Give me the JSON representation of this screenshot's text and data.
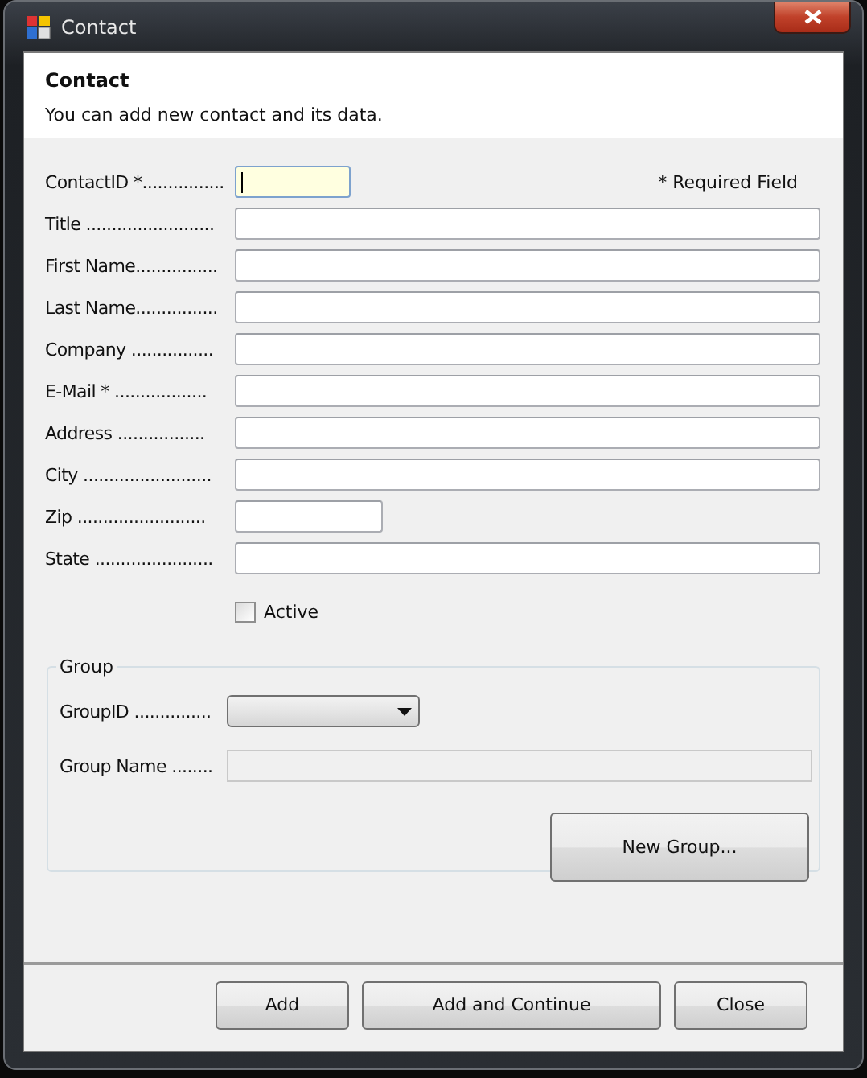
{
  "window": {
    "title": "Contact"
  },
  "header": {
    "title": "Contact",
    "subtitle": "You can add new contact and its data."
  },
  "required_note": "* Required Field",
  "fields": [
    {
      "label": "ContactID *................",
      "kind": "id",
      "focused": true
    },
    {
      "label": "Title .........................",
      "kind": "wide",
      "focused": false
    },
    {
      "label": "First Name................",
      "kind": "wide",
      "focused": false
    },
    {
      "label": "Last Name................",
      "kind": "wide",
      "focused": false
    },
    {
      "label": "Company ................",
      "kind": "wide",
      "focused": false
    },
    {
      "label": "E-Mail * ..................",
      "kind": "wide",
      "focused": false
    },
    {
      "label": "Address  .................",
      "kind": "wide",
      "focused": false
    },
    {
      "label": "City  .........................",
      "kind": "wide",
      "focused": false
    },
    {
      "label": "Zip  .........................",
      "kind": "short",
      "focused": false
    },
    {
      "label": "State  .......................",
      "kind": "wide",
      "focused": false
    }
  ],
  "active": {
    "label": "Active",
    "checked": false
  },
  "group": {
    "title": "Group",
    "group_id_label": "GroupID  ...............",
    "group_name_label": "Group Name  ........",
    "group_name_disabled": true,
    "new_button": "New Group..."
  },
  "buttons": [
    "Add",
    "Add and Continue",
    "Close"
  ]
}
